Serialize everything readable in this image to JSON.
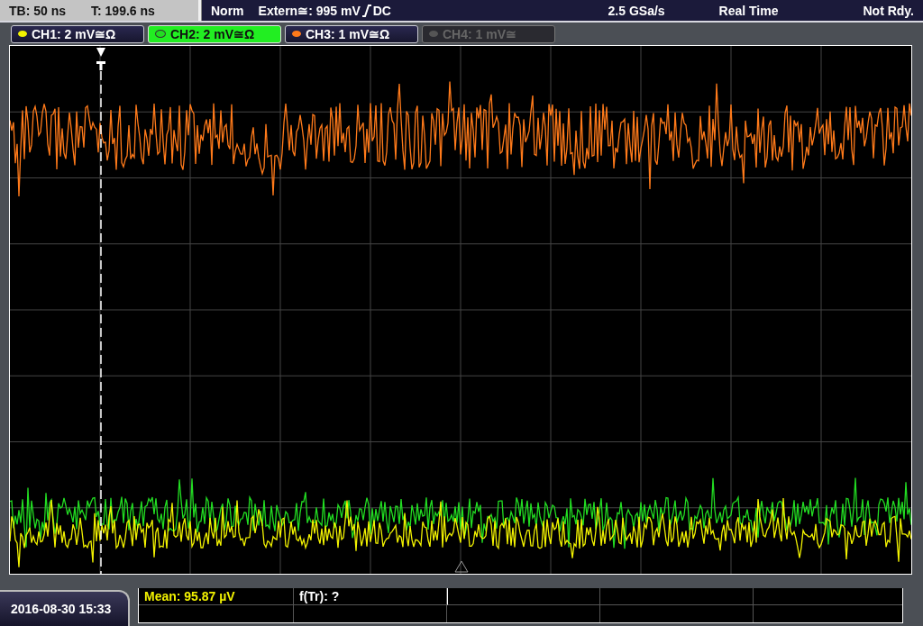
{
  "status_bar": {
    "timebase": "TB: 50 ns",
    "trigger_time": "T: 199.6 ns",
    "mode": "Norm",
    "trigger_source": "Extern≅: 995 mV",
    "coupling": "DC",
    "sample_rate": "2.5 GSa/s",
    "acquisition": "Real Time",
    "state": "Not Rdy."
  },
  "channels": [
    {
      "label": "CH1: 2 mV≅Ω",
      "color": "#f2f200",
      "selected": false,
      "disabled": false
    },
    {
      "label": "CH2: 2 mV≅Ω",
      "color": "#22dd22",
      "selected": true,
      "disabled": false
    },
    {
      "label": "CH3: 1 mV≅Ω",
      "color": "#ff7a1a",
      "selected": false,
      "disabled": false
    },
    {
      "label": "CH4: 1 mV≅",
      "color": "#555555",
      "selected": false,
      "disabled": true
    }
  ],
  "measurements": [
    {
      "text": "Mean: 95.87 µV",
      "kind": "channel"
    },
    {
      "text": "f(Tr): ?",
      "kind": "counter"
    }
  ],
  "timestamp": "2016-08-30 15:33"
}
